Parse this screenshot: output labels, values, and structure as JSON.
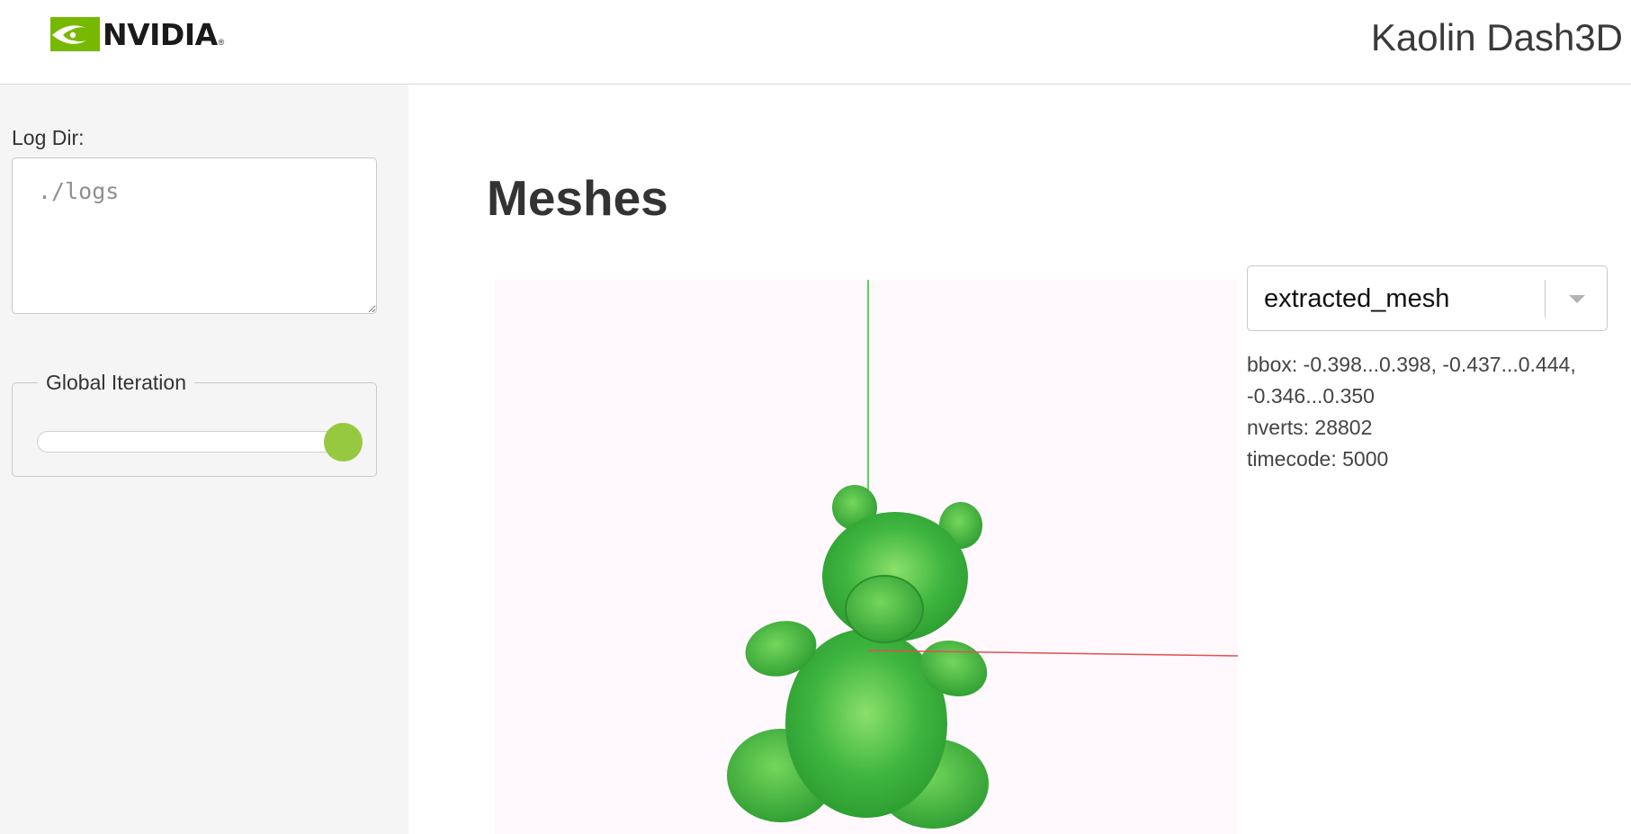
{
  "header": {
    "brand": "NVIDIA",
    "brand_mark": "®",
    "title": "Kaolin Dash3D",
    "logo_icon": "nvidia-eye-icon",
    "accent_color": "#76b900"
  },
  "sidebar": {
    "log_dir": {
      "label": "Log Dir:",
      "placeholder": "./logs",
      "value": ""
    },
    "global_iteration": {
      "label": "Global Iteration",
      "value_fraction": 1.0,
      "thumb_color": "#97c940"
    }
  },
  "main": {
    "heading": "Meshes",
    "viewer": {
      "background": "#fff9fd",
      "mesh_color": "#3cb043",
      "y_axis_color": "#22cc22",
      "x_axis_color": "#e05050"
    },
    "mesh_select": {
      "selected": "extracted_mesh",
      "icon": "chevron-down-icon"
    },
    "info": {
      "bbox_line1": "bbox: -0.398...0.398, -0.437...0.444,",
      "bbox_line2": "-0.346...0.350",
      "nverts": "nverts: 28802",
      "timecode": "timecode: 5000"
    }
  }
}
